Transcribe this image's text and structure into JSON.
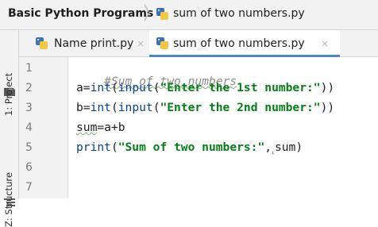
{
  "breadcrumb": {
    "project": "Basic Python Programs",
    "file": "sum of two numbers.py"
  },
  "sidebar": {
    "project_label": "1: Project",
    "structure_label": "Z: Structure"
  },
  "tabs": [
    {
      "label": "Name print.py",
      "close": "×",
      "active": false
    },
    {
      "label": "sum of two numbers.py",
      "close": "×",
      "active": true
    }
  ],
  "editor": {
    "line_numbers": [
      "1",
      "2",
      "3",
      "4",
      "5",
      "6",
      "7"
    ],
    "lines": [
      {
        "comment": "#Sum of two numbers"
      },
      {
        "var": "a",
        "op": "=",
        "f1": "int",
        "p1": "(",
        "f2": "input",
        "p2": "(",
        "str": "\"Enter the 1st number:\"",
        "close": "))"
      },
      {
        "var": "b",
        "op": "=",
        "f1": "int",
        "p1": "(",
        "f2": "input",
        "p2": "(",
        "str": "\"Enter the 2nd number:\"",
        "close": "))"
      },
      {
        "var": "sum",
        "op": "=a+b"
      },
      {
        "f1": "print",
        "p1": "(",
        "str": "\"Sum of two numbers:\"",
        "comma": ",",
        "hint": "⸤",
        "arg": "sum",
        "close": ")"
      }
    ]
  },
  "colors": {
    "keyword_builtin": "#0b3f8f",
    "string": "#067d17",
    "comment": "#8c8c8c",
    "active_tab_underline": "#4a88c7"
  },
  "icons": {
    "python_file": "python-file-icon",
    "folder": "folder-icon",
    "structure": "structure-icon"
  }
}
